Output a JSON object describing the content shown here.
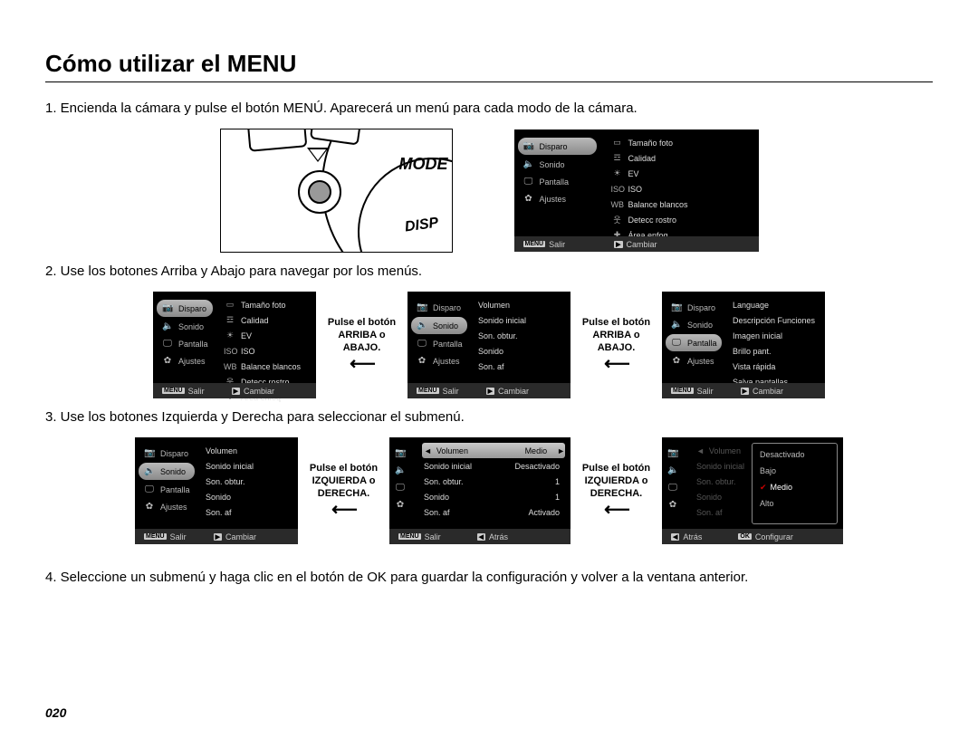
{
  "title": "Cómo utilizar el MENU",
  "page_number": "020",
  "steps": {
    "s1": "1. Encienda la cámara y pulse el botón MENÚ. Aparecerá un menú para cada modo de la cámara.",
    "s2": "2. Use los botones Arriba y Abajo para navegar por los menús.",
    "s3": "3. Use los botones Izquierda y Derecha para seleccionar el submenú.",
    "s4": "4. Seleccione un submenú y haga clic en el botón de OK para guardar la configuración y volver a la ventana anterior."
  },
  "captions": {
    "updown": {
      "l1": "Pulse el botón",
      "l2": "ARRIBA o",
      "l3": "ABAJO."
    },
    "leftright": {
      "l1": "Pulse el botón",
      "l2": "IZQUIERDA o",
      "l3": "DERECHA."
    }
  },
  "illus": {
    "mode": "MODE",
    "disp": "DISP"
  },
  "menu": {
    "left_tabs": {
      "disparo": "Disparo",
      "sonido": "Sonido",
      "pantalla": "Pantalla",
      "ajustes": "Ajustes"
    },
    "icons": {
      "disparo": "📷",
      "sonido": "🔈",
      "pantalla": "🖵",
      "ajustes": "✿"
    },
    "disparo_items": {
      "i0": "Tamaño foto",
      "i1": "Calidad",
      "i2": "EV",
      "i3": "ISO",
      "i4": "Balance blancos",
      "i5": "Detecc rostro",
      "i6": "Área enfoq"
    },
    "disparo_icons": {
      "i0": "▭",
      "i1": "☲",
      "i2": "☀",
      "i3": "ISO",
      "i4": "WB",
      "i5": "웃",
      "i6": "✚"
    },
    "sonido_items": {
      "i0": "Volumen",
      "i1": "Sonido inicial",
      "i2": "Son. obtur.",
      "i3": "Sonido",
      "i4": "Son. af"
    },
    "sonido_values": {
      "i0": "Medio",
      "i1": "Desactivado",
      "i2": "1",
      "i3": "1",
      "i4": "Activado"
    },
    "pantalla_items": {
      "i0": "Language",
      "i1": "Descripción Funciones",
      "i2": "Imagen inicial",
      "i3": "Brillo pant.",
      "i4": "Vista rápida",
      "i5": "Salva pantallas"
    },
    "volumen_popup": {
      "p0": "Desactivado",
      "p1": "Bajo",
      "p2": "Medio",
      "p3": "Alto"
    }
  },
  "footer": {
    "menu": "MENU",
    "play": "▶",
    "back": "◀",
    "salir": "Salir",
    "cambiar": "Cambiar",
    "atras": "Atrás",
    "configurar": "Configurar"
  }
}
